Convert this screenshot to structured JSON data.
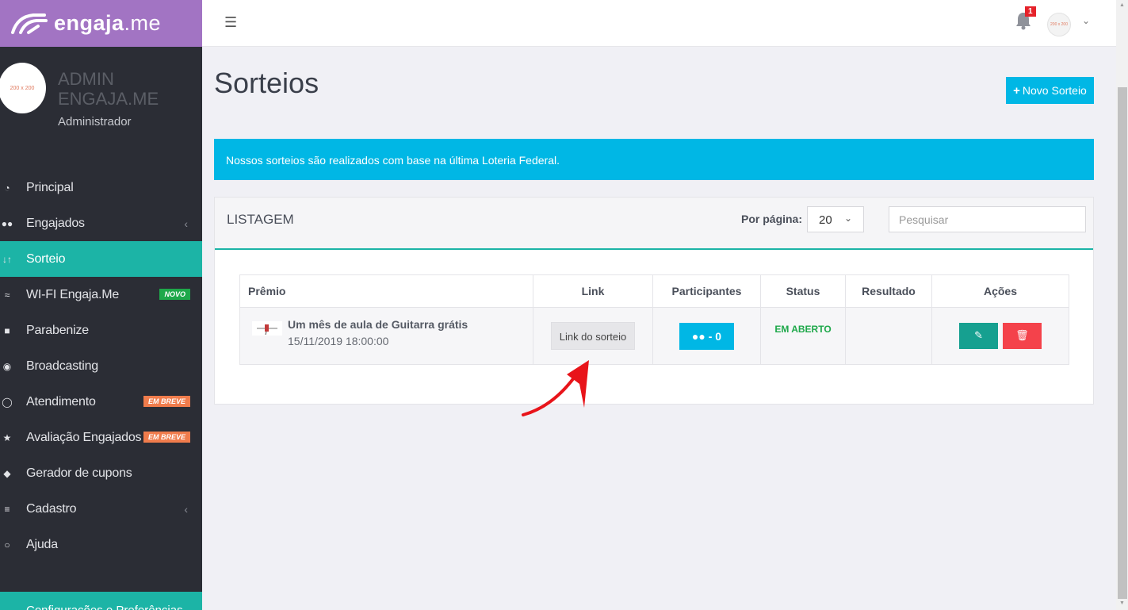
{
  "brand": {
    "name_bold": "engaja",
    "name_suffix": ".me"
  },
  "profile": {
    "avatar_text": "200 x 200",
    "name": "ADMIN ENGAJA.ME",
    "role": "Administrador"
  },
  "sidebar": {
    "items": [
      {
        "label": "Principal",
        "icon": "dashboard-icon"
      },
      {
        "label": "Engajados",
        "icon": "users-icon",
        "has_caret": true
      },
      {
        "label": "Sorteio",
        "icon": "sort-icon",
        "active": true
      },
      {
        "label": "WI-FI Engaja.Me",
        "icon": "wifi-icon",
        "badge": "NOVO"
      },
      {
        "label": "Parabenize",
        "icon": "gift-icon"
      },
      {
        "label": "Broadcasting",
        "icon": "broadcast-icon"
      },
      {
        "label": "Atendimento",
        "icon": "chat-icon",
        "badge": "EM BREVE"
      },
      {
        "label": "Avaliação Engajados",
        "icon": "star-icon",
        "badge": "EM BREVE"
      },
      {
        "label": "Gerador de cupons",
        "icon": "tag-icon"
      },
      {
        "label": "Cadastro",
        "icon": "sliders-icon",
        "has_caret": true
      },
      {
        "label": "Ajuda",
        "icon": "lightbulb-icon"
      }
    ],
    "config_label": "Configurações e Preferências"
  },
  "topbar": {
    "notification_count": "1",
    "user_thumb_text": "200 x 200"
  },
  "page": {
    "title": "Sorteios",
    "new_button": "Novo Sorteio",
    "info_banner": "Nossos sorteios são realizados com base na última Loteria Federal."
  },
  "listing": {
    "title": "LISTAGEM",
    "per_page_label": "Por página:",
    "per_page_value": "20",
    "search_placeholder": "Pesquisar",
    "columns": [
      "Prêmio",
      "Link",
      "Participantes",
      "Status",
      "Resultado",
      "Ações"
    ],
    "rows": [
      {
        "prize_name": "Um mês de aula de Guitarra grátis",
        "prize_date": "15/11/2019 18:00:00",
        "link_label": "Link do sorteio",
        "participants": "0",
        "status": "EM ABERTO",
        "result": ""
      }
    ]
  },
  "colors": {
    "accent": "#1cb4a6",
    "primary": "#00b7e5",
    "brand": "#a274c3",
    "danger": "#f4424b",
    "success": "#1ea84a"
  }
}
